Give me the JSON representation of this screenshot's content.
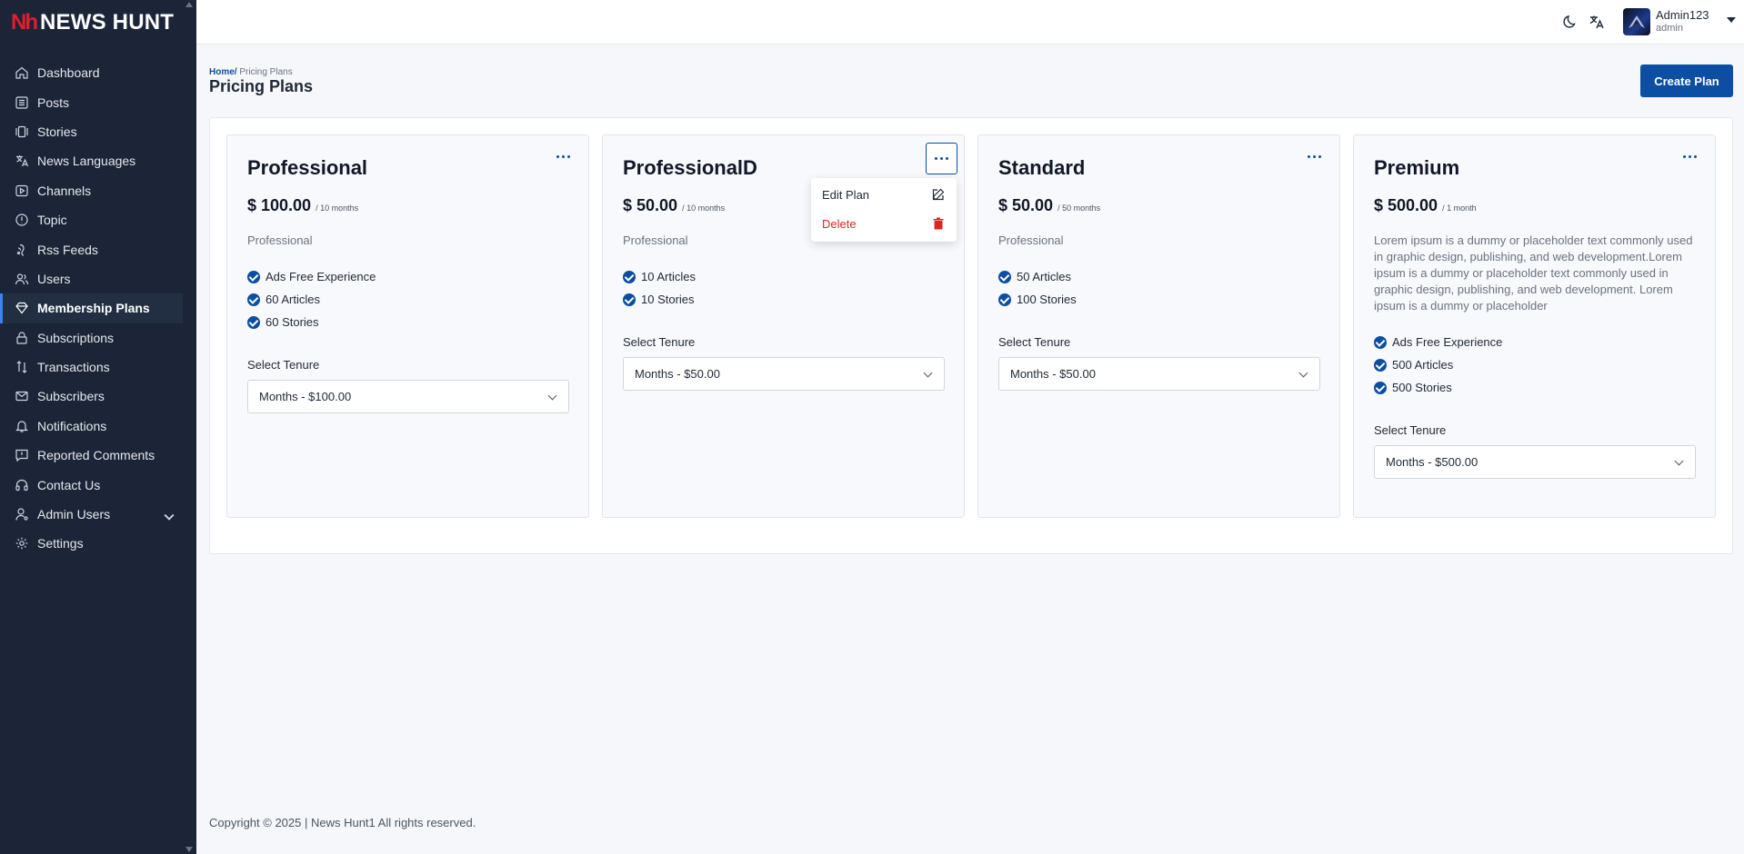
{
  "app": {
    "logo_mark": "Nh",
    "logo_text": "NEWS HUNT"
  },
  "sidebar": {
    "items": [
      {
        "label": "Dashboard",
        "icon": "home-icon"
      },
      {
        "label": "Posts",
        "icon": "posts-icon"
      },
      {
        "label": "Stories",
        "icon": "stories-icon"
      },
      {
        "label": "News Languages",
        "icon": "translate-icon"
      },
      {
        "label": "Channels",
        "icon": "play-icon"
      },
      {
        "label": "Topic",
        "icon": "info-icon"
      },
      {
        "label": "Rss Feeds",
        "icon": "rss-icon"
      },
      {
        "label": "Users",
        "icon": "users-icon"
      },
      {
        "label": "Membership Plans",
        "icon": "diamond-icon",
        "active": true
      },
      {
        "label": "Subscriptions",
        "icon": "lock-icon"
      },
      {
        "label": "Transactions",
        "icon": "transfer-icon"
      },
      {
        "label": "Subscribers",
        "icon": "mail-icon"
      },
      {
        "label": "Notifications",
        "icon": "bell-icon"
      },
      {
        "label": "Reported Comments",
        "icon": "comment-alert-icon"
      },
      {
        "label": "Contact Us",
        "icon": "headset-icon"
      },
      {
        "label": "Admin Users",
        "icon": "admin-user-icon",
        "expandable": true
      },
      {
        "label": "Settings",
        "icon": "gear-icon"
      }
    ]
  },
  "header": {
    "user_name": "Admin123",
    "user_role": "admin",
    "icons": [
      "moon-icon",
      "translate-icon"
    ]
  },
  "page": {
    "breadcrumb_home": "Home/",
    "breadcrumb_current": " Pricing Plans",
    "title": "Pricing Plans",
    "create_button": "Create Plan"
  },
  "plans": [
    {
      "name": "Professional",
      "price": "$ 100.00",
      "period": "/ 10 months",
      "description": "Professional",
      "features": [
        "Ads Free Experience",
        "60 Articles",
        "60 Stories"
      ],
      "tenure_label": "Select Tenure",
      "tenure_value": "Months - $100.00"
    },
    {
      "name": "ProfessionalD",
      "price": "$ 50.00",
      "period": "/ 10 months",
      "description": "Professional",
      "features": [
        "10 Articles",
        "10 Stories"
      ],
      "tenure_label": "Select Tenure",
      "tenure_value": "Months - $50.00"
    },
    {
      "name": "Standard",
      "price": "$ 50.00",
      "period": "/ 50 months",
      "description": "Professional",
      "features": [
        "50 Articles",
        "100 Stories"
      ],
      "tenure_label": "Select Tenure",
      "tenure_value": "Months - $50.00"
    },
    {
      "name": "Premium",
      "price": "$ 500.00",
      "period": "/ 1 month",
      "description": "Lorem ipsum is a dummy or placeholder text commonly used in graphic design, publishing, and web development.Lorem ipsum is a dummy or placeholder text commonly used in graphic design, publishing, and web development. Lorem ipsum is a dummy or placeholder",
      "features": [
        "Ads Free Experience",
        "500 Articles",
        "500 Stories"
      ],
      "tenure_label": "Select Tenure",
      "tenure_value": "Months - $500.00"
    }
  ],
  "dropdown": {
    "edit_label": "Edit Plan",
    "delete_label": "Delete"
  },
  "footer": {
    "text": "Copyright © 2025 | News Hunt1 All rights reserved."
  },
  "colors": {
    "sidebar_bg": "#1b2537",
    "primary": "#0b4ea2",
    "danger": "#dc2626",
    "brand_red": "#e11d2e"
  }
}
